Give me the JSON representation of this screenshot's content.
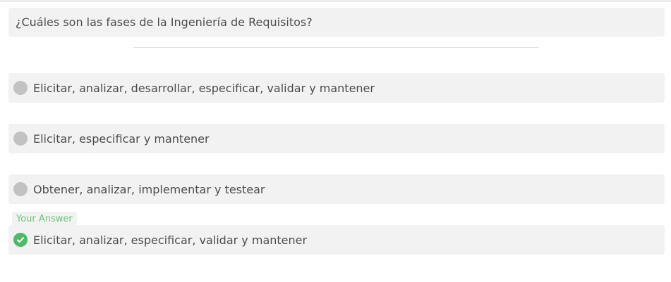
{
  "question": {
    "text": "¿Cuáles son las fases de la Ingeniería de Requisitos?"
  },
  "options": [
    {
      "label": "Elicitar, analizar, desarrollar, especificar, validar y mantener",
      "state": "unselected"
    },
    {
      "label": "Elicitar, especificar y mantener",
      "state": "unselected"
    },
    {
      "label": "Obtener, analizar, implementar y testear",
      "state": "unselected"
    },
    {
      "label": "Elicitar, analizar, especificar, validar y mantener",
      "state": "selected-correct"
    }
  ],
  "your_answer_tag": "Your Answer",
  "colors": {
    "option_bg": "#f2f2f2",
    "radio_unselected": "#c2c2c2",
    "correct_green": "#4fb96a",
    "tag_text": "#6ec27a"
  },
  "icons": {
    "unselected": "radio-circle-icon",
    "correct": "check-circle-icon"
  }
}
